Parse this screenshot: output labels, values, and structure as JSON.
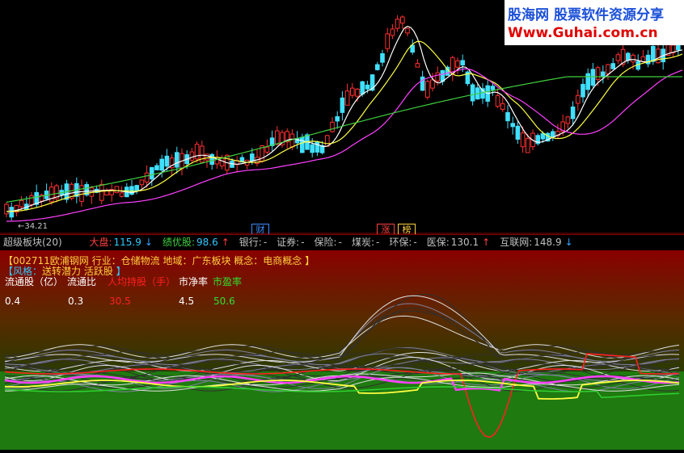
{
  "watermark": {
    "brand": "股海网",
    "slogan": "股票软件资源分享",
    "url": "Www.Guhai.com.cn"
  },
  "main_chart": {
    "low_price_label": "←34.21",
    "markers": [
      {
        "text": "财",
        "color": "#3a8cff"
      },
      {
        "text": "涨",
        "color": "#ff4040"
      },
      {
        "text": "榜",
        "color": "#ffd040"
      }
    ]
  },
  "status_bar": {
    "panel_name": "超级板块(20)",
    "indices": [
      {
        "label": "大盘:",
        "value": "115.9",
        "arrow": "↓",
        "dir": "down"
      },
      {
        "label": "绩优股:",
        "value": "98.6",
        "arrow": "↑",
        "dir": "up"
      },
      {
        "label": "银行:",
        "value": "-",
        "arrow": "",
        "dir": "none"
      },
      {
        "label": "证券:",
        "value": "-",
        "arrow": "",
        "dir": "none"
      },
      {
        "label": "保险:",
        "value": "-",
        "arrow": "",
        "dir": "none"
      },
      {
        "label": "煤炭:",
        "value": "-",
        "arrow": "",
        "dir": "none"
      },
      {
        "label": "环保:",
        "value": "-",
        "arrow": "",
        "dir": "none"
      },
      {
        "label": "医保:",
        "value": "130.1",
        "arrow": "↑",
        "dir": "up"
      },
      {
        "label": "互联网:",
        "value": "148.9",
        "arrow": "↓",
        "dir": "down"
      }
    ]
  },
  "stock_info": {
    "line1": "【002711欧浦钢网 行业：仓储物流 地域：广东板块 概念：电商概念 】",
    "style_prefix": "【风格：",
    "style_value": "送转潜力 活跃股",
    "style_suffix": " 】"
  },
  "metrics": {
    "headers": [
      "流通股（亿）",
      "流通比",
      "人均持股（手）",
      "市净率",
      "市盈率"
    ],
    "values": [
      "0.4",
      "0.3",
      "30.5",
      "4.5",
      "50.6"
    ],
    "header_colors": [
      "#ffffff",
      "#ffffff",
      "#ff2020",
      "#ffffff",
      "#30e030"
    ],
    "value_colors": [
      "#ffffff",
      "#ffffff",
      "#ff2020",
      "#ffffff",
      "#30e030"
    ]
  },
  "colors": {
    "up_candle": "#ff3030",
    "down_candle": "#40e0ff",
    "ma_short": "#ffffff",
    "ma_mid": "#ffff40",
    "ma_long": "#ff40ff",
    "ma_year": "#40d040"
  }
}
